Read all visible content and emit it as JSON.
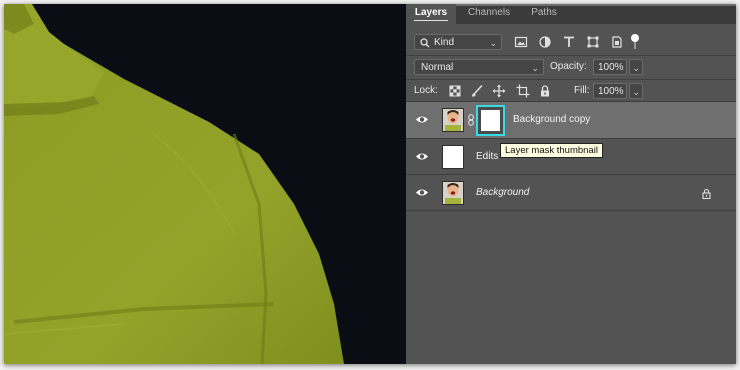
{
  "tabs": [
    {
      "label": "Layers",
      "active": true
    },
    {
      "label": "Channels",
      "active": false
    },
    {
      "label": "Paths",
      "active": false
    }
  ],
  "filter": {
    "kind_label": "Kind",
    "icons": [
      "image-filter-icon",
      "adjustment-filter-icon",
      "type-filter-icon",
      "shape-filter-icon",
      "smart-object-filter-icon",
      "filter-toggle-icon"
    ]
  },
  "blend": {
    "mode": "Normal",
    "opacity_label": "Opacity:",
    "opacity_value": "100%"
  },
  "lock": {
    "label": "Lock:",
    "icons": [
      "lock-transparent-pixels-icon",
      "lock-image-pixels-icon",
      "lock-position-icon",
      "lock-artboard-icon",
      "lock-all-icon"
    ],
    "fill_label": "Fill:",
    "fill_value": "100%"
  },
  "layers": [
    {
      "name": "Background copy",
      "selected": true,
      "has_mask": true,
      "italic": false,
      "locked": false
    },
    {
      "name": "Edits",
      "selected": false,
      "has_mask": false,
      "italic": false,
      "locked": false
    },
    {
      "name": "Background",
      "selected": false,
      "has_mask": false,
      "italic": true,
      "locked": true
    }
  ],
  "tooltip": "Layer mask thumbnail",
  "colors": {
    "panel_bg": "#535353",
    "selected_row": "#6f6f6f",
    "mask_highlight": "#3ad9e6",
    "canvas_bg": "#0b0d14",
    "shirt": "#8a9a24"
  }
}
